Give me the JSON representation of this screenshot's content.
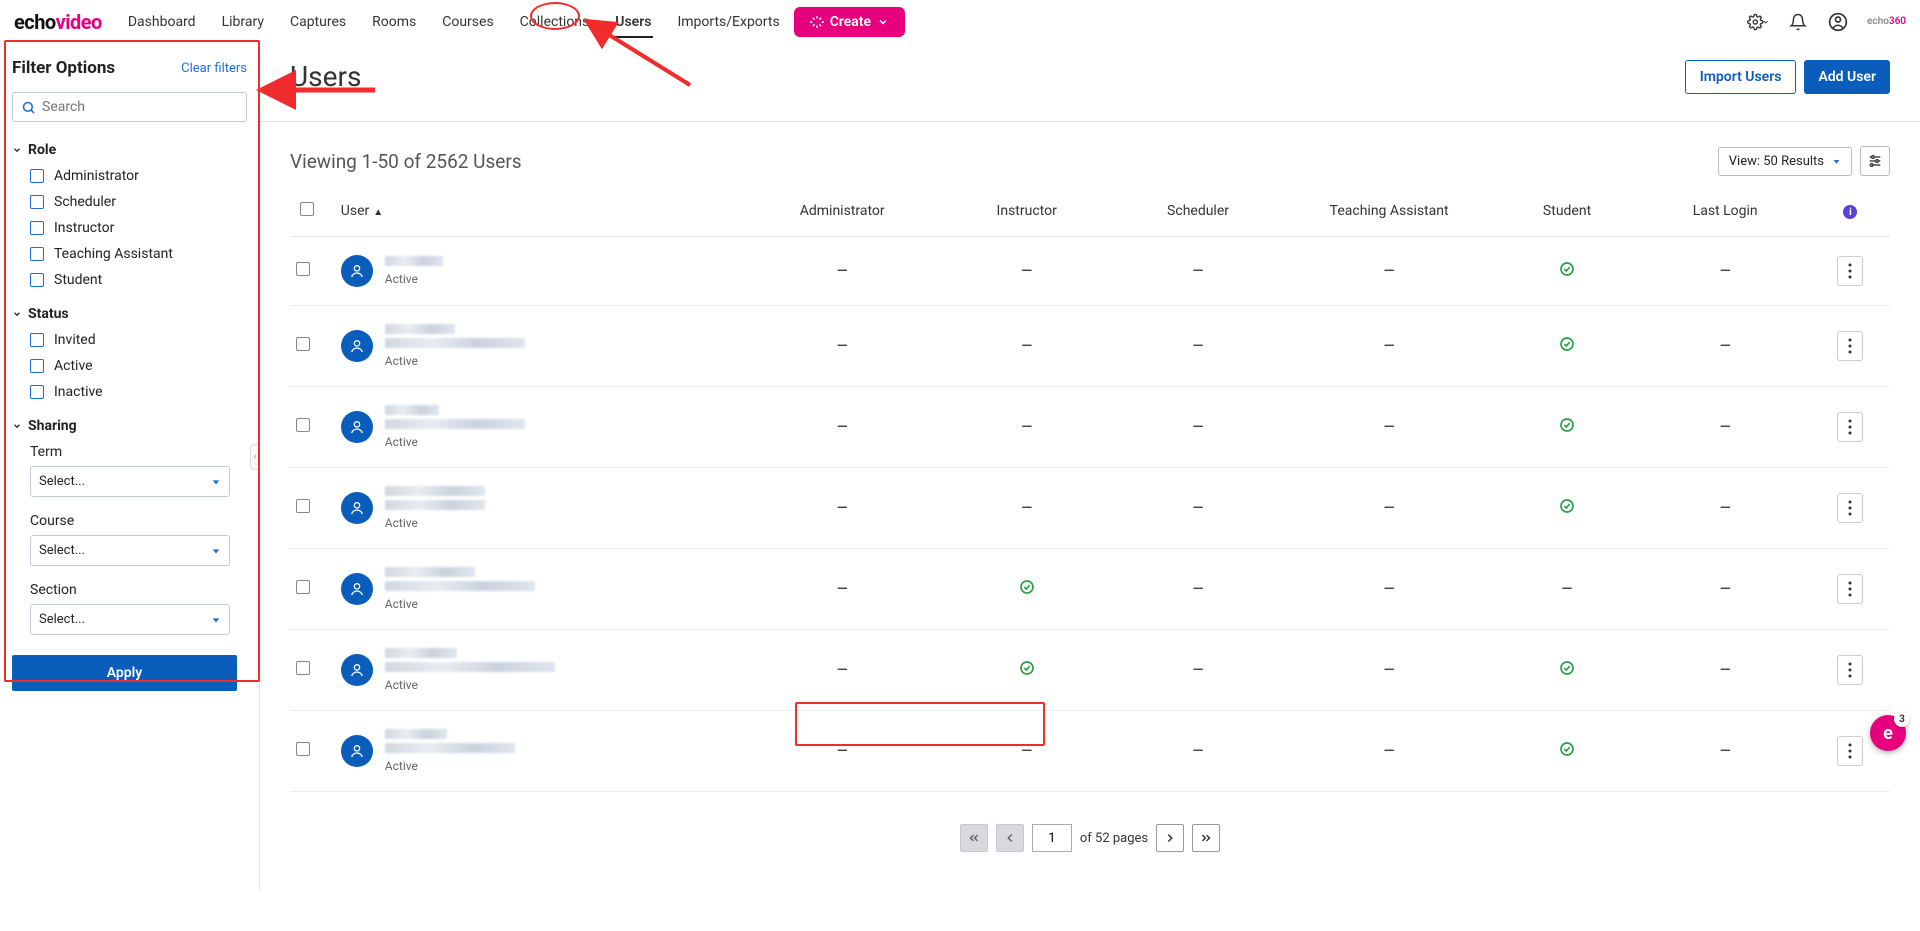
{
  "brand": {
    "part1": "echo",
    "part2": "video"
  },
  "nav": {
    "items": [
      "Dashboard",
      "Library",
      "Captures",
      "Rooms",
      "Courses",
      "Collections",
      "Users",
      "Imports/Exports"
    ],
    "activeIndex": 6,
    "create": "Create"
  },
  "miniLogo": {
    "part1": "echo",
    "part2": "360"
  },
  "sidebar": {
    "title": "Filter Options",
    "clear": "Clear filters",
    "searchPlaceholder": "Search",
    "role": {
      "label": "Role",
      "options": [
        "Administrator",
        "Scheduler",
        "Instructor",
        "Teaching Assistant",
        "Student"
      ]
    },
    "status": {
      "label": "Status",
      "options": [
        "Invited",
        "Active",
        "Inactive"
      ]
    },
    "sharing": {
      "label": "Sharing",
      "term": {
        "label": "Term",
        "placeholder": "Select..."
      },
      "course": {
        "label": "Course",
        "placeholder": "Select..."
      },
      "section": {
        "label": "Section",
        "placeholder": "Select..."
      }
    },
    "apply": "Apply"
  },
  "page": {
    "title": "Users",
    "import": "Import Users",
    "add": "Add User"
  },
  "results": {
    "viewing": "Viewing 1-50 of 2562 Users",
    "viewLabel": "View: 50 Results"
  },
  "columns": {
    "user": "User",
    "admin": "Administrator",
    "instructor": "Instructor",
    "scheduler": "Scheduler",
    "ta": "Teaching Assistant",
    "student": "Student",
    "lastLogin": "Last Login"
  },
  "rows": [
    {
      "status": "Active",
      "nameW": 58,
      "subW": 0,
      "admin": "—",
      "inst": "—",
      "sched": "—",
      "ta": "—",
      "student": "✓",
      "last": "—"
    },
    {
      "status": "Active",
      "nameW": 70,
      "subW": 140,
      "admin": "—",
      "inst": "—",
      "sched": "—",
      "ta": "—",
      "student": "✓",
      "last": "—"
    },
    {
      "status": "Active",
      "nameW": 54,
      "subW": 140,
      "admin": "—",
      "inst": "—",
      "sched": "—",
      "ta": "—",
      "student": "✓",
      "last": "—"
    },
    {
      "status": "Active",
      "nameW": 100,
      "subW": 100,
      "admin": "—",
      "inst": "—",
      "sched": "—",
      "ta": "—",
      "student": "✓",
      "last": "—"
    },
    {
      "status": "Active",
      "nameW": 90,
      "subW": 150,
      "admin": "—",
      "inst": "✓",
      "sched": "—",
      "ta": "—",
      "student": "—",
      "last": "—"
    },
    {
      "status": "Active",
      "nameW": 72,
      "subW": 170,
      "admin": "—",
      "inst": "✓",
      "sched": "—",
      "ta": "—",
      "student": "✓",
      "last": "—"
    },
    {
      "status": "Active",
      "nameW": 62,
      "subW": 130,
      "admin": "—",
      "inst": "—",
      "sched": "—",
      "ta": "—",
      "student": "✓",
      "last": "—"
    }
  ],
  "pager": {
    "current": "1",
    "of": "of 52 pages"
  },
  "badge": {
    "letter": "e",
    "count": "3"
  }
}
